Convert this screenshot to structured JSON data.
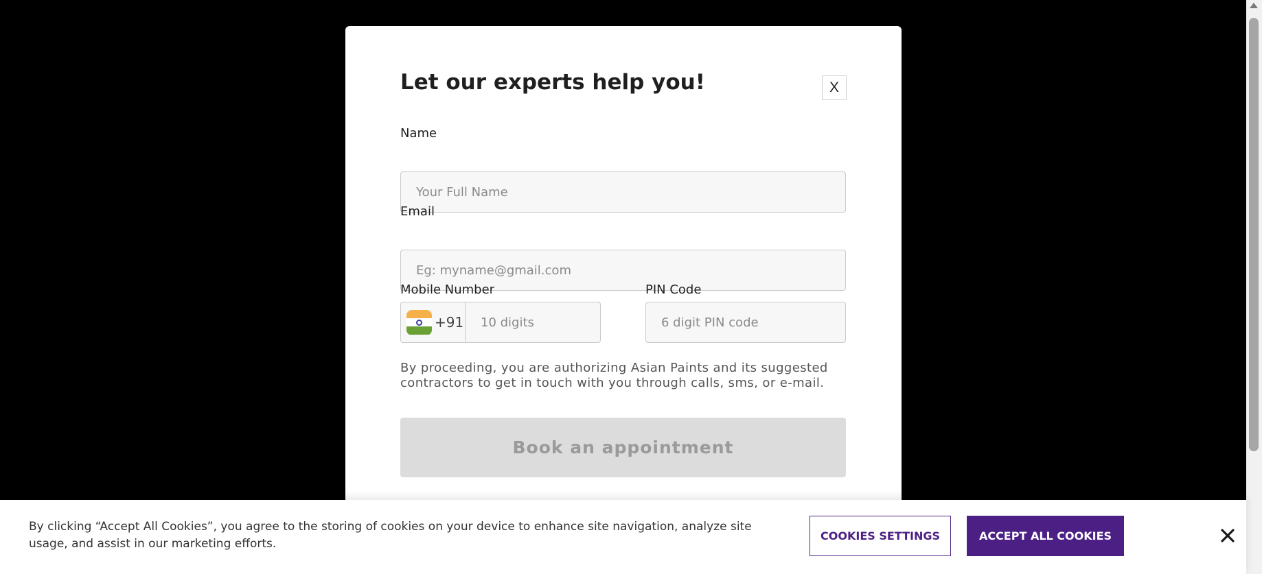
{
  "modal": {
    "title": "Let our experts help you!",
    "close_label": "X",
    "name_label": "Name",
    "name_placeholder": "Your Full Name",
    "email_label": "Email",
    "email_placeholder": "Eg: myname@gmail.com",
    "mobile_label": "Mobile Number",
    "country_code": "+91",
    "country_flag_icon": "india-flag-icon",
    "mobile_placeholder": "10 digits",
    "pin_label": "PIN Code",
    "pin_placeholder": "6 digit PIN code",
    "consent_text": "By proceeding, you are authorizing Asian Paints and its suggested contractors to get in touch with you through calls, sms, or e-mail.",
    "submit_label": "Book an appointment"
  },
  "cookie_banner": {
    "text": "By clicking “Accept All Cookies”, you agree to the storing of cookies on your device to enhance site navigation, analyze site usage, and assist in our marketing efforts.",
    "settings_label": "COOKIES SETTINGS",
    "accept_label": "ACCEPT ALL COOKIES",
    "close_icon": "close-icon"
  },
  "colors": {
    "accent": "#4b1f84",
    "overlay": "#000000",
    "disabled_button": "#dcdcdc"
  }
}
